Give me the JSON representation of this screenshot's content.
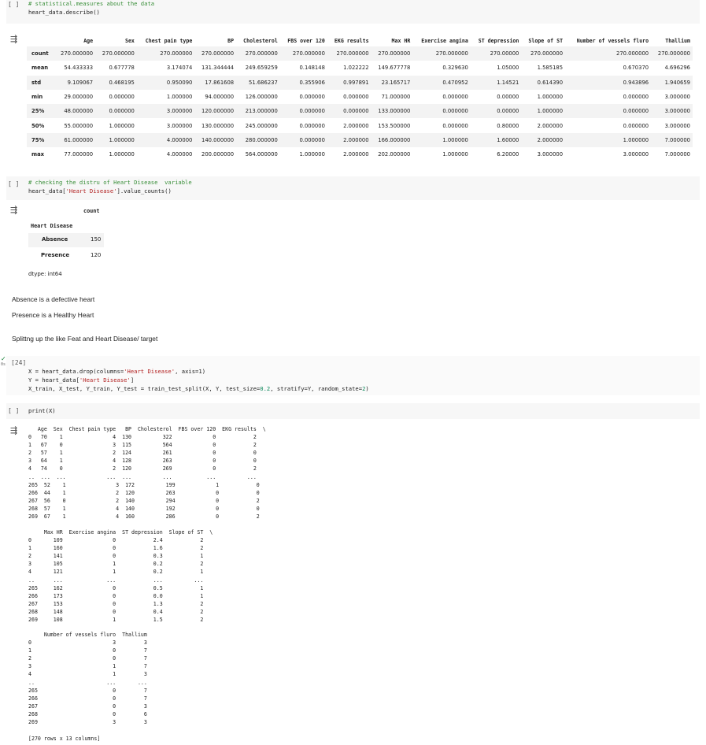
{
  "cell1": {
    "run_label": "[ ]",
    "code_comment": "# statistical.measures about the data",
    "code_line": "heart_data.describe()"
  },
  "describe_table": {
    "columns": [
      "Age",
      "Sex",
      "Chest pain type",
      "BP",
      "Cholesterol",
      "FBS over 120",
      "EKG results",
      "Max HR",
      "Exercise angina",
      "ST depression",
      "Slope of ST",
      "Number of vessels fluro",
      "Thallium"
    ],
    "rows": [
      {
        "idx": "count",
        "values": [
          "270.000000",
          "270.000000",
          "270.000000",
          "270.000000",
          "270.000000",
          "270.000000",
          "270.000000",
          "270.000000",
          "270.000000",
          "270.00000",
          "270.000000",
          "270.000000",
          "270.000000"
        ]
      },
      {
        "idx": "mean",
        "values": [
          "54.433333",
          "0.677778",
          "3.174074",
          "131.344444",
          "249.659259",
          "0.148148",
          "1.022222",
          "149.677778",
          "0.329630",
          "1.05000",
          "1.585185",
          "0.670370",
          "4.696296"
        ]
      },
      {
        "idx": "std",
        "values": [
          "9.109067",
          "0.468195",
          "0.950090",
          "17.861608",
          "51.686237",
          "0.355906",
          "0.997891",
          "23.165717",
          "0.470952",
          "1.14521",
          "0.614390",
          "0.943896",
          "1.940659"
        ]
      },
      {
        "idx": "min",
        "values": [
          "29.000000",
          "0.000000",
          "1.000000",
          "94.000000",
          "126.000000",
          "0.000000",
          "0.000000",
          "71.000000",
          "0.000000",
          "0.00000",
          "1.000000",
          "0.000000",
          "3.000000"
        ]
      },
      {
        "idx": "25%",
        "values": [
          "48.000000",
          "0.000000",
          "3.000000",
          "120.000000",
          "213.000000",
          "0.000000",
          "0.000000",
          "133.000000",
          "0.000000",
          "0.00000",
          "1.000000",
          "0.000000",
          "3.000000"
        ]
      },
      {
        "idx": "50%",
        "values": [
          "55.000000",
          "1.000000",
          "3.000000",
          "130.000000",
          "245.000000",
          "0.000000",
          "2.000000",
          "153.500000",
          "0.000000",
          "0.80000",
          "2.000000",
          "0.000000",
          "3.000000"
        ]
      },
      {
        "idx": "75%",
        "values": [
          "61.000000",
          "1.000000",
          "4.000000",
          "140.000000",
          "280.000000",
          "0.000000",
          "2.000000",
          "166.000000",
          "1.000000",
          "1.60000",
          "2.000000",
          "1.000000",
          "7.000000"
        ]
      },
      {
        "idx": "max",
        "values": [
          "77.000000",
          "1.000000",
          "4.000000",
          "200.000000",
          "564.000000",
          "1.000000",
          "2.000000",
          "202.000000",
          "1.000000",
          "6.20000",
          "3.000000",
          "3.000000",
          "7.000000"
        ]
      }
    ]
  },
  "cell2": {
    "run_label": "[ ]",
    "code_comment": "# checking the distru of Heart Disease  variable",
    "code_prefix": "heart_data[",
    "code_string": "'Heart Disease'",
    "code_suffix": "].value_counts()"
  },
  "value_counts": {
    "col_header": "count",
    "index_header": "Heart Disease",
    "rows": [
      {
        "label": "Absence",
        "count": "150"
      },
      {
        "label": "Presence",
        "count": "120"
      }
    ],
    "dtype": "dtype: int64"
  },
  "markdown": {
    "line1": "Absence is a defective heart",
    "line2": "Presence is a Healthy Heart",
    "line3": "Splittng up the like Feat and Heart Disease/ target"
  },
  "cell3": {
    "run_label": "[24]",
    "exec_time": "0s",
    "line1_a": "X = heart_data.drop(columns=",
    "line1_s": "'Heart Disease'",
    "line1_b": ", axis=1)",
    "line2_a": "Y = heart_data[",
    "line2_s": "'Heart Disease'",
    "line2_b": "]",
    "line3_a": "X_train, X_test, Y_train, Y_test = train_test_split(X, Y, test_size=",
    "line3_n": "0.2",
    "line3_b": ", stratify=Y, random_state=",
    "line3_n2": "2",
    "line3_c": ")"
  },
  "cell4": {
    "run_label": "[ ]",
    "code_line": "print(X)"
  },
  "print_output": {
    "block1": "   Age  Sex  Chest pain type   BP  Cholesterol  FBS over 120  EKG results  \\\n0   70    1                4  130          322             0            2\n1   67    0                3  115          564             0            2\n2   57    1                2  124          261             0            0\n3   64    1                4  128          263             0            0\n4   74    0                2  120          269             0            2\n..  ...  ...             ...  ...          ...           ...          ...\n265  52    1                3  172          199             1            0\n266  44    1                2  120          263             0            0\n267  56    0                2  140          294             0            2\n268  57    1                4  140          192             0            0\n269  67    1                4  160          286             0            2",
    "block2": "     Max HR  Exercise angina  ST depression  Slope of ST  \\\n0       109                0            2.4            2\n1       160                0            1.6            2\n2       141                0            0.3            1\n3       105                1            0.2            2\n4       121                1            0.2            1\n..      ...              ...            ...          ...\n265     162                0            0.5            1\n266     173                0            0.0            1\n267     153                0            1.3            2\n268     148                0            0.4            2\n269     108                1            1.5            2",
    "block3": "     Number of vessels fluro  Thallium\n0                          3         3\n1                          0         7\n2                          0         7\n3                          1         7\n4                          1         3\n..                       ...       ...\n265                        0         7\n266                        0         7\n267                        0         3\n268                        0         6\n269                        3         3",
    "footer": "[270 rows x 13 columns]"
  }
}
